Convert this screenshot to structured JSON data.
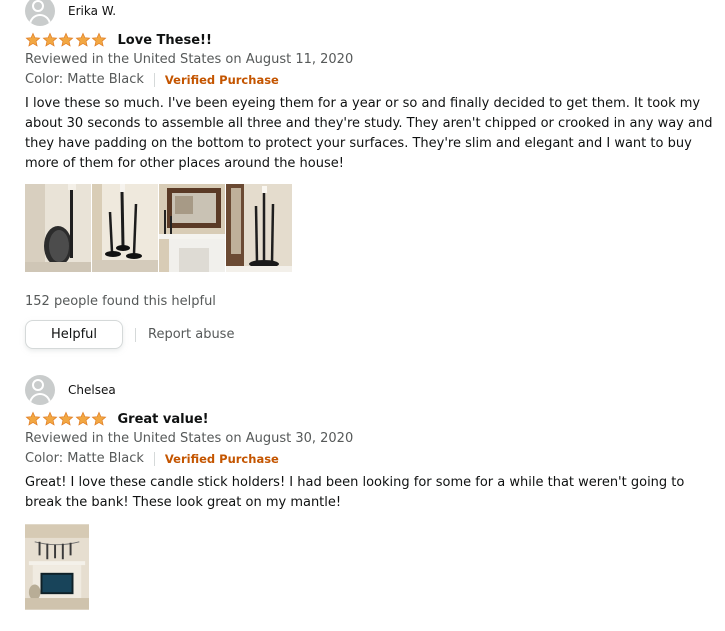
{
  "reviews": [
    {
      "name": "Erika W.",
      "rating": 5,
      "title": "Love These!!",
      "reviewed": "Reviewed in the United States on August 11, 2020",
      "color": "Color: Matte Black",
      "verified": "Verified Purchase",
      "body": "I love these so much. I've been eyeing them for a year or so and finally decided to get them. It took my about 30 seconds to assemble all three and they're study. They aren't chipped or crooked in any way and they have padding on the bottom to protect your surfaces. They're slim and elegant and I want to buy more of them for other places around the house!",
      "helpful_count": "152 people found this helpful",
      "helpful_button": "Helpful",
      "report": "Report abuse"
    },
    {
      "name": "Chelsea",
      "rating": 5,
      "title": "Great value!",
      "reviewed": "Reviewed in the United States on August 30, 2020",
      "color": "Color: Matte Black",
      "verified": "Verified Purchase",
      "body": "Great! I love these candle stick holders! I had been looking for some for a while that weren't going to break the bank! These look great on my mantle!"
    }
  ],
  "colors": {
    "star": "#f2a742",
    "verified": "#c45500",
    "muted": "#565959"
  }
}
